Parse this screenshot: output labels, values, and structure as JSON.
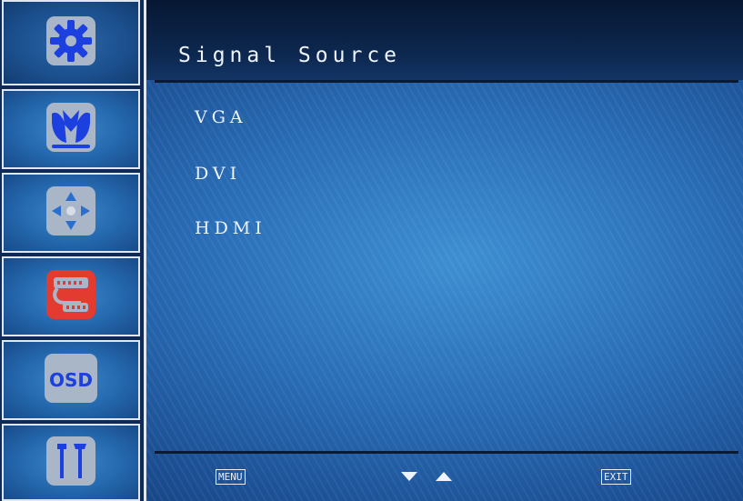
{
  "sidebar": {
    "items": [
      {
        "icon": "gear-icon",
        "color": "#1c3fe0"
      },
      {
        "icon": "color-adjust-icon",
        "color": "#1c3fe0"
      },
      {
        "icon": "position-icon",
        "color": "#a9b6c7"
      },
      {
        "icon": "input-cable-icon",
        "color": "#e33b2f"
      },
      {
        "icon": "osd-icon",
        "label": "OSD",
        "color": "#1c3fe0"
      },
      {
        "icon": "tools-icon",
        "color": "#1c3fe0"
      }
    ]
  },
  "menu": {
    "title": "Signal Source",
    "options": [
      "VGA",
      "DVI",
      "HDMI"
    ]
  },
  "footer": {
    "menu_key": "MENU",
    "exit_key": "EXIT"
  },
  "colors": {
    "panel_blue": "#2a6fb8",
    "header_dark": "#0d2850",
    "text": "#eef4ff"
  }
}
